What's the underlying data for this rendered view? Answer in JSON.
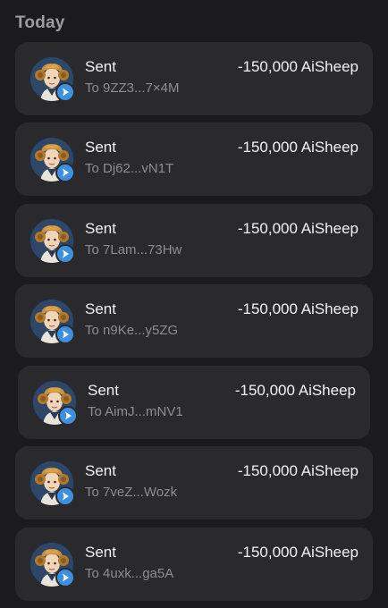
{
  "section": {
    "title": "Today"
  },
  "transactions": [
    {
      "title": "Sent",
      "recipient": "To 9ZZ3...7×4M",
      "amount": "-150,000 AiSheep"
    },
    {
      "title": "Sent",
      "recipient": "To Dj62...vN1T",
      "amount": "-150,000 AiSheep"
    },
    {
      "title": "Sent",
      "recipient": "To 7Lam...73Hw",
      "amount": "-150,000 AiSheep"
    },
    {
      "title": "Sent",
      "recipient": "To n9Ke...y5ZG",
      "amount": "-150,000 AiSheep"
    },
    {
      "title": "Sent",
      "recipient": "To AimJ...mNV1",
      "amount": "-150,000 AiSheep"
    },
    {
      "title": "Sent",
      "recipient": "To 7veZ...Wozk",
      "amount": "-150,000 AiSheep"
    },
    {
      "title": "Sent",
      "recipient": "To 4uxk...ga5A",
      "amount": "-150,000 AiSheep"
    }
  ],
  "icons": {
    "avatar": "ram-character-avatar",
    "badge": "send-arrow-icon"
  },
  "colors": {
    "background": "#1b1b1d",
    "card": "#2a2a2d",
    "badge": "#3d8fe0",
    "muted": "#8d8c92"
  }
}
